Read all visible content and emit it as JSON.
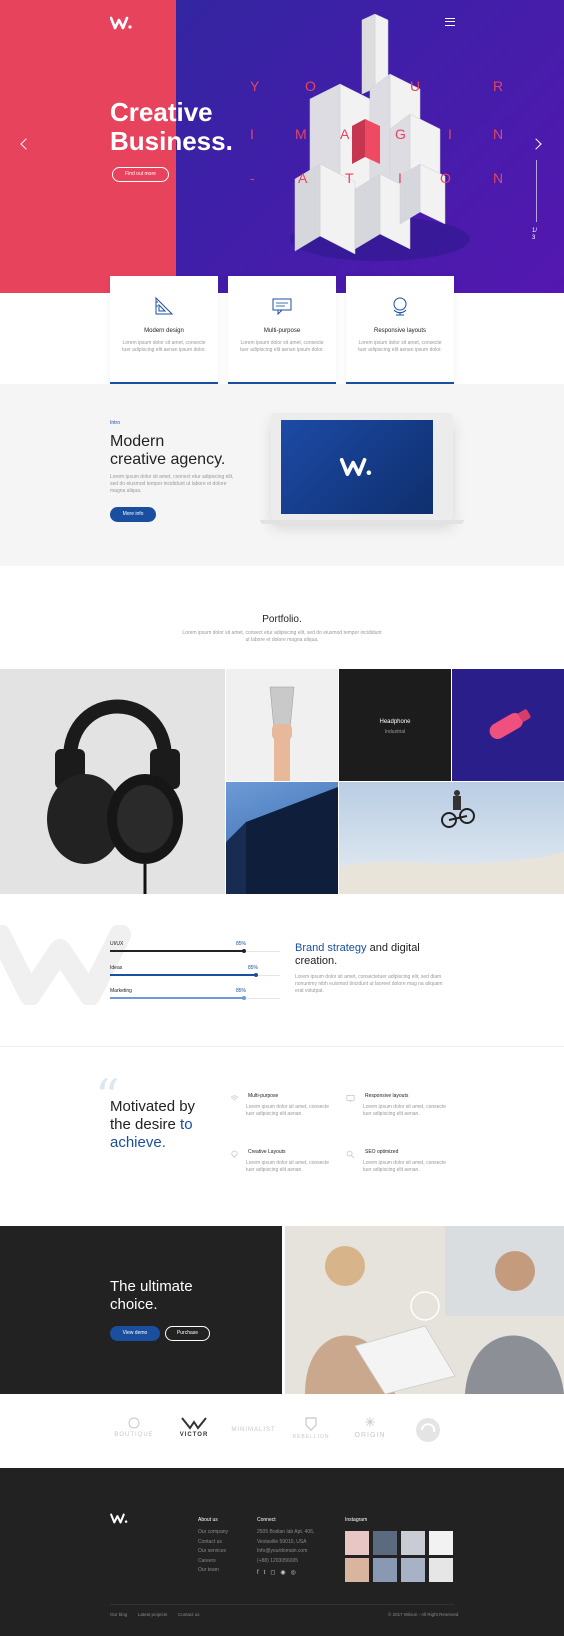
{
  "hero": {
    "title_line1": "Creative",
    "title_line2": "Business.",
    "cta": "Find out more",
    "pager_current": "1/",
    "pager_total": "3",
    "word_rows": [
      [
        "Y",
        "O",
        "U",
        "R"
      ],
      [
        "I",
        "M",
        "A",
        "G",
        "I",
        "N"
      ],
      [
        "-",
        "A",
        "T",
        "I",
        "O",
        "N"
      ]
    ],
    "colors": {
      "left": "#e8435c",
      "right": "#3a22a6",
      "accent": "#1a4fa0"
    }
  },
  "features": [
    {
      "title": "Modern design",
      "desc": "Lorem ipsum dolor sit amet, consecte tuer adipiscing elit aenan ipsum dolor.",
      "icon": "ruler-triangle-icon"
    },
    {
      "title": "Multi-purpose",
      "desc": "Lorem ipsum dolor sit amet, consecte tuer adipiscing elit aenan ipsum dolor.",
      "icon": "chat-bubble-icon"
    },
    {
      "title": "Responsive layouts",
      "desc": "Lorem ipsum dolor sit amet, consecte tuer adipiscing elit aenan ipsum dolor.",
      "icon": "globe-icon"
    }
  ],
  "intro": {
    "label": "Intro",
    "title_line1": "Modern",
    "title_line2": "creative agency.",
    "desc": "Lorem ipsum dolor sit amet, connect etur adipiscing elit, sed do eiusmod tempor incididunt ut labore et dolore magna aliqua.",
    "button": "More info"
  },
  "portfolio": {
    "title": "Portfolio.",
    "desc": "Lorem ipsum dolor sit amet, consect etur adipiscing elit, sed do eiusmod tempor incididunt ut labore et dolore magna aliqua.",
    "featured_title": "Headphone",
    "featured_category": "Industrial"
  },
  "skills": [
    {
      "label": "UI/UX",
      "value": 85,
      "percent_text": "85%"
    },
    {
      "label": "Ideas",
      "value": 85,
      "percent_text": "85%"
    },
    {
      "label": "Marketing",
      "value": 85,
      "percent_text": "85%"
    }
  ],
  "brand": {
    "highlight": "Brand strategy",
    "rest1": " and digital",
    "rest2": "creation.",
    "desc": "Lorem ipsum dolor sit amet, consectetuer adipiscing elit, sed diam nonummy nibh euismod tincidunt ut laoreet dolore mag na aliquam erat volutpat."
  },
  "motivated": {
    "line1": "Motivated by",
    "line2": "the desire ",
    "line2_hl": "to",
    "line3_hl": "achieve.",
    "services": [
      {
        "title": "Multi-purpose",
        "desc": "Lorem ipsum dolor sit amet, consecte tuer adipiscing elit aenan.",
        "icon": "wifi-icon"
      },
      {
        "title": "Responsive layouts",
        "desc": "Lorem ipsum dolor sit amet, consecte tuer adipiscing elit aenan.",
        "icon": "monitor-icon"
      },
      {
        "title": "Creative Layouts",
        "desc": "Lorem ipsum dolor sit amet, consecte tuer adipiscing elit aenan.",
        "icon": "lightbulb-icon"
      },
      {
        "title": "SEO optimized",
        "desc": "Lorem ipsum dolor sit amet, consecte tuer adipiscing elit aenan.",
        "icon": "magnifier-icon"
      }
    ]
  },
  "choice": {
    "line1": "The ultimate",
    "line2": "choice.",
    "demo": "View demo",
    "purchase": "Purchase"
  },
  "clients": [
    "BOUTIQUE",
    "VICTOR",
    "MINIMALIST",
    "REBELLION",
    "ORIGIN",
    ""
  ],
  "footer": {
    "about_title": "About us",
    "about_links": [
      "Our company",
      "Contact us",
      "Our services",
      "Careers",
      "Our team"
    ],
    "connect_title": "Connect",
    "connect_lines": [
      "2505 Bodian lab Apt. 406,",
      "Vestaville 59010, USA",
      "Info@yourdomain.com",
      "(+88) 1203056005"
    ],
    "instagram_title": "Instagram",
    "bottom_links": [
      "Our blog",
      "Latest projects",
      "Contact us"
    ],
    "copyright": "© 2017 Wilson - All Right Reserved"
  }
}
